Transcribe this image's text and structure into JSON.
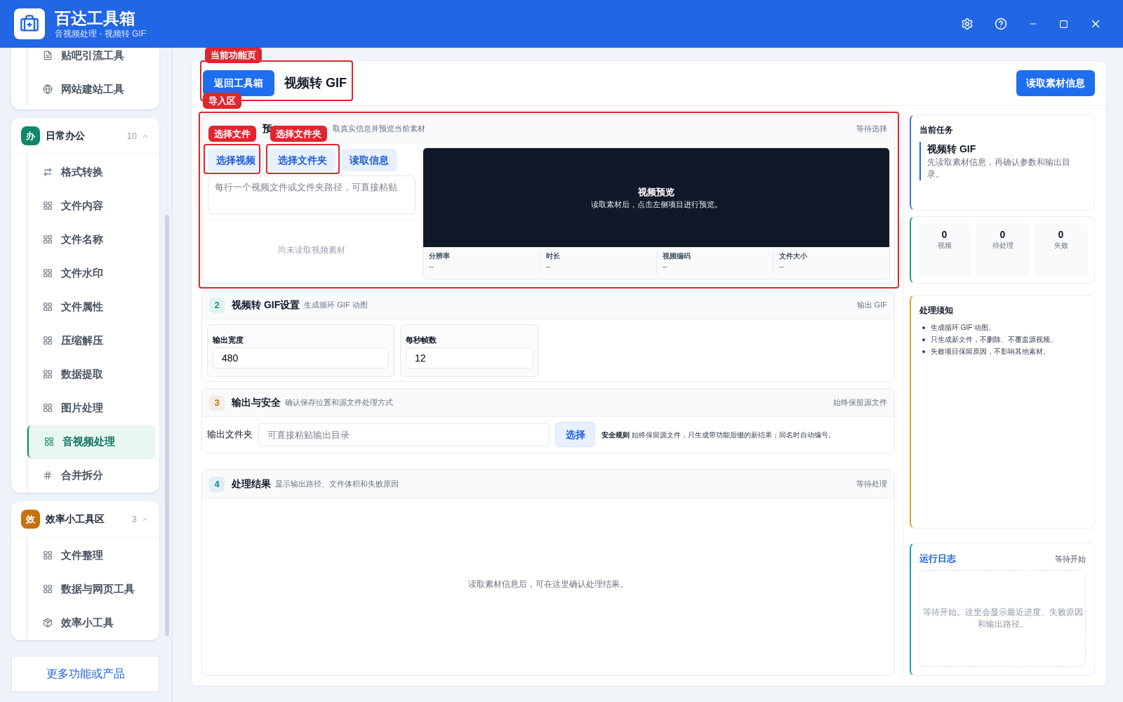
{
  "app": {
    "title": "百达工具箱",
    "subtitle": "音视频处理 - 视频转 GIF"
  },
  "sidebar": {
    "groups": [
      {
        "items": [
          {
            "label": "贴吧引流工具",
            "kind": "doc",
            "selected": false
          },
          {
            "label": "网站建站工具",
            "kind": "globe",
            "selected": false
          }
        ]
      },
      {
        "badge": "办",
        "title": "日常办公",
        "count": "10",
        "expanded": true,
        "color": "#11876a",
        "items": [
          {
            "label": "格式转换",
            "kind": "swap",
            "selected": false
          },
          {
            "label": "文件内容",
            "kind": "grid",
            "selected": false
          },
          {
            "label": "文件名称",
            "kind": "grid",
            "selected": false
          },
          {
            "label": "文件水印",
            "kind": "grid",
            "selected": false
          },
          {
            "label": "文件属性",
            "kind": "grid",
            "selected": false
          },
          {
            "label": "压缩解压",
            "kind": "grid",
            "selected": false
          },
          {
            "label": "数据提取",
            "kind": "grid",
            "selected": false
          },
          {
            "label": "图片处理",
            "kind": "grid",
            "selected": false
          },
          {
            "label": "音视频处理",
            "kind": "grid",
            "selected": true
          },
          {
            "label": "合并拆分",
            "kind": "hash",
            "selected": false
          }
        ]
      },
      {
        "badge": "效",
        "title": "效率小工具区",
        "count": "3",
        "expanded": true,
        "color": "#c8700e",
        "items": [
          {
            "label": "文件整理",
            "kind": "grid",
            "selected": false
          },
          {
            "label": "数据与网页工具",
            "kind": "grid",
            "selected": false
          },
          {
            "label": "效率小工具",
            "kind": "box",
            "selected": false
          }
        ]
      }
    ],
    "more_button": "更多功能或产品"
  },
  "main": {
    "back_button": "返回工具箱",
    "title": "视频转 GIF",
    "read_button": "读取素材信息"
  },
  "annotations": [
    {
      "label": "当前功能页"
    },
    {
      "label": "导入区"
    },
    {
      "label": "选择文件"
    },
    {
      "label": "选择文件夹"
    }
  ],
  "import": {
    "title": "预",
    "subtitle": "取真实信息并预览当前素材",
    "status": "等待选择",
    "buttons": [
      "选择视频",
      "选择文件夹",
      "读取信息"
    ],
    "path_placeholder": "每行一个视频文件或文件夹路径，可直接粘贴",
    "empty": "尚未读取视频素材",
    "preview": {
      "title": "视频预览",
      "hint": "读取素材后，点击左侧项目进行预览。"
    },
    "meta": [
      {
        "label": "分辨率",
        "value": "--"
      },
      {
        "label": "时长",
        "value": "--"
      },
      {
        "label": "视频编码",
        "value": "--"
      },
      {
        "label": "文件大小",
        "value": "--"
      }
    ]
  },
  "settings": {
    "number": "2",
    "color": "#0f9d77",
    "title": "视频转 GIF设置",
    "subtitle": "生成循环 GIF 动图",
    "status": "输出 GIF",
    "fields": [
      {
        "label": "输出宽度",
        "value": "480"
      },
      {
        "label": "每秒帧数",
        "value": "12"
      }
    ]
  },
  "output": {
    "number": "3",
    "color": "#c27a10",
    "title": "输出与安全",
    "subtitle": "确认保存位置和源文件处理方式",
    "status": "始终保留源文件",
    "field_label": "输出文件夹",
    "placeholder": "可直接粘贴输出目录",
    "button": "选择",
    "rule_title": "安全规则",
    "rule_text": "始终保留源文件，只生成带功能后缀的新结果；同名时自动编号。"
  },
  "results": {
    "number": "4",
    "color": "#0e8aa0",
    "title": "处理结果",
    "subtitle": "显示输出路径、文件体积和失败原因",
    "status": "等待处理",
    "empty": "读取素材信息后，可在这里确认处理结果。"
  },
  "task": {
    "heading": "当前任务",
    "title": "视频转 GIF",
    "desc": "先读取素材信息，再确认参数和输出目录。"
  },
  "stats": [
    {
      "value": "0",
      "label": "视频"
    },
    {
      "value": "0",
      "label": "待处理"
    },
    {
      "value": "0",
      "label": "失败"
    }
  ],
  "notes": {
    "heading": "处理须知",
    "items": [
      "生成循环 GIF 动图。",
      "只生成新文件，不删除、不覆盖源视频。",
      "失败项目保留原因，不影响其他素材。"
    ]
  },
  "log": {
    "title": "运行日志",
    "status": "等待开始",
    "placeholder": "等待开始。这里会显示最近进度、失败原因和输出路径。"
  }
}
